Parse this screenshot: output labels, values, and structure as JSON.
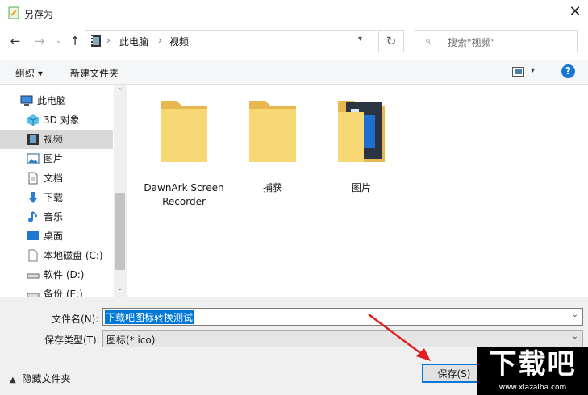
{
  "window": {
    "title": "另存为"
  },
  "address": {
    "segments": [
      "此电脑",
      "视频"
    ]
  },
  "search": {
    "placeholder": "搜索\"视频\""
  },
  "toolbar": {
    "organize": "组织 ▾",
    "new_folder": "新建文件夹"
  },
  "sidebar": {
    "items": [
      {
        "label": "此电脑",
        "icon": "computer-icon"
      },
      {
        "label": "3D 对象",
        "icon": "3d-objects-icon"
      },
      {
        "label": "视频",
        "icon": "video-icon"
      },
      {
        "label": "图片",
        "icon": "pictures-icon"
      },
      {
        "label": "文档",
        "icon": "documents-icon"
      },
      {
        "label": "下载",
        "icon": "download-icon"
      },
      {
        "label": "音乐",
        "icon": "music-icon"
      },
      {
        "label": "桌面",
        "icon": "desktop-icon"
      },
      {
        "label": "本地磁盘 (C:)",
        "icon": "drive-icon"
      },
      {
        "label": "软件 (D:)",
        "icon": "drive-icon"
      },
      {
        "label": "备份 (E:)",
        "icon": "drive-icon"
      }
    ]
  },
  "files": [
    {
      "label": "DawnArk Screen Recorder"
    },
    {
      "label": "捕获"
    },
    {
      "label": "图片"
    }
  ],
  "form": {
    "filename_label": "文件名(N):",
    "filename_value": "下载吧图标转换测试",
    "filetype_label": "保存类型(T):",
    "filetype_value": "图标(*.ico)"
  },
  "footer": {
    "hide_folders": "隐藏文件夹",
    "save": "保存(S)"
  },
  "watermark": {
    "text": "下载吧",
    "url": "www.xiazaiba.com"
  },
  "colors": {
    "accent": "#0078d7",
    "selection": "#0078d7",
    "arrow": "#e02020",
    "folder": "#f8d775"
  }
}
